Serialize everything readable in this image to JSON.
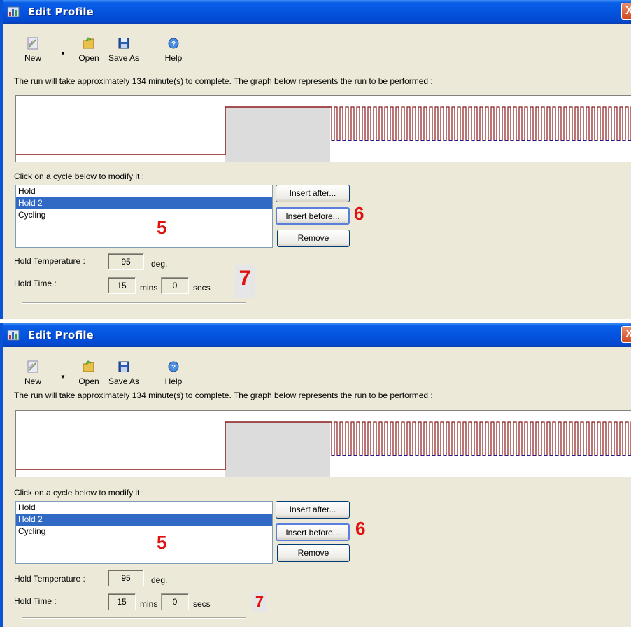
{
  "windows": [
    {
      "title": "Edit Profile",
      "close_label": "X",
      "toolbar": {
        "new": "New",
        "open": "Open",
        "save_as": "Save As",
        "help": "Help"
      },
      "info_text": "The run will take approximately 134 minute(s) to complete. The graph below represents the run to be performed :",
      "list_label": "Click on a cycle below to modify it :",
      "cycles": [
        "Hold",
        "Hold 2",
        "Cycling"
      ],
      "selected_cycle": "Hold 2",
      "buttons": {
        "insert_after": "Insert after...",
        "insert_before": "Insert before...",
        "remove": "Remove"
      },
      "hold_temperature_label": "Hold Temperature :",
      "hold_temperature_value": "95",
      "hold_temperature_unit": "deg.",
      "hold_time_label": "Hold Time :",
      "hold_time_mins": "15",
      "hold_time_mins_unit": "mins",
      "hold_time_secs": "0",
      "hold_time_secs_unit": "secs",
      "callouts": {
        "list": "5",
        "buttons": "6",
        "fields": "7"
      }
    },
    {
      "title": "Edit Profile",
      "close_label": "X",
      "toolbar": {
        "new": "New",
        "open": "Open",
        "save_as": "Save As",
        "help": "Help"
      },
      "info_text": "The run will take approximately 134 minute(s) to complete. The graph below represents the run to be performed :",
      "list_label": "Click on a cycle below to modify it :",
      "cycles": [
        "Hold",
        "Hold 2",
        "Cycling"
      ],
      "selected_cycle": "Hold 2",
      "buttons": {
        "insert_after": "Insert after...",
        "insert_before": "Insert before...",
        "remove": "Remove"
      },
      "hold_temperature_label": "Hold Temperature :",
      "hold_temperature_value": "95",
      "hold_temperature_unit": "deg.",
      "hold_time_label": "Hold Time :",
      "hold_time_mins": "15",
      "hold_time_mins_unit": "mins",
      "hold_time_secs": "0",
      "hold_time_secs_unit": "secs",
      "callouts": {
        "list": "5",
        "buttons": "6",
        "fields": "7"
      }
    }
  ],
  "colors": {
    "titlebar": "#0454e0",
    "selection": "#316ac5",
    "profile_line": "#8b1a1a",
    "cycle_marker": "#1a1a9e",
    "highlight_segment": "#dcdcdc",
    "callout": "#e01010"
  },
  "icons": [
    "app-icon",
    "new-profile-icon",
    "open-folder-icon",
    "save-disk-icon",
    "help-icon",
    "dropdown-arrow-icon",
    "close-icon"
  ]
}
